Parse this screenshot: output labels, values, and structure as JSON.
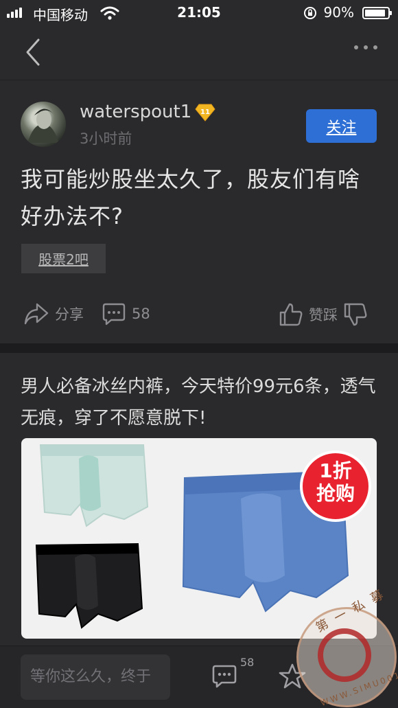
{
  "status_bar": {
    "carrier": "中国移动",
    "time": "21:05",
    "battery_percent": "90%",
    "battery_level": 0.9
  },
  "post": {
    "username": "waterspout1",
    "level": "11",
    "time": "3小时前",
    "follow_label": "关注",
    "title": "我可能炒股坐太久了，股友们有啥好办法不?",
    "tag": "股票2吧"
  },
  "actions": {
    "share_label": "分享",
    "comment_count": "58",
    "vote_label": "赞踩"
  },
  "ad": {
    "text": "男人必备冰丝内裤，今天特价99元6条，透气无痕，穿了不愿意脱下!",
    "badge_line1": "1折",
    "badge_line2": "抢购"
  },
  "bottom_bar": {
    "input_placeholder": "等你这么久，终于",
    "comment_count": "58"
  },
  "watermark": {
    "top_text": "第一私募",
    "bottom_text": "WWW.SIMU001.CN"
  },
  "colors": {
    "background": "#2a2a2c",
    "accent_blue": "#2e6fd6",
    "sale_red": "#e8222e"
  }
}
